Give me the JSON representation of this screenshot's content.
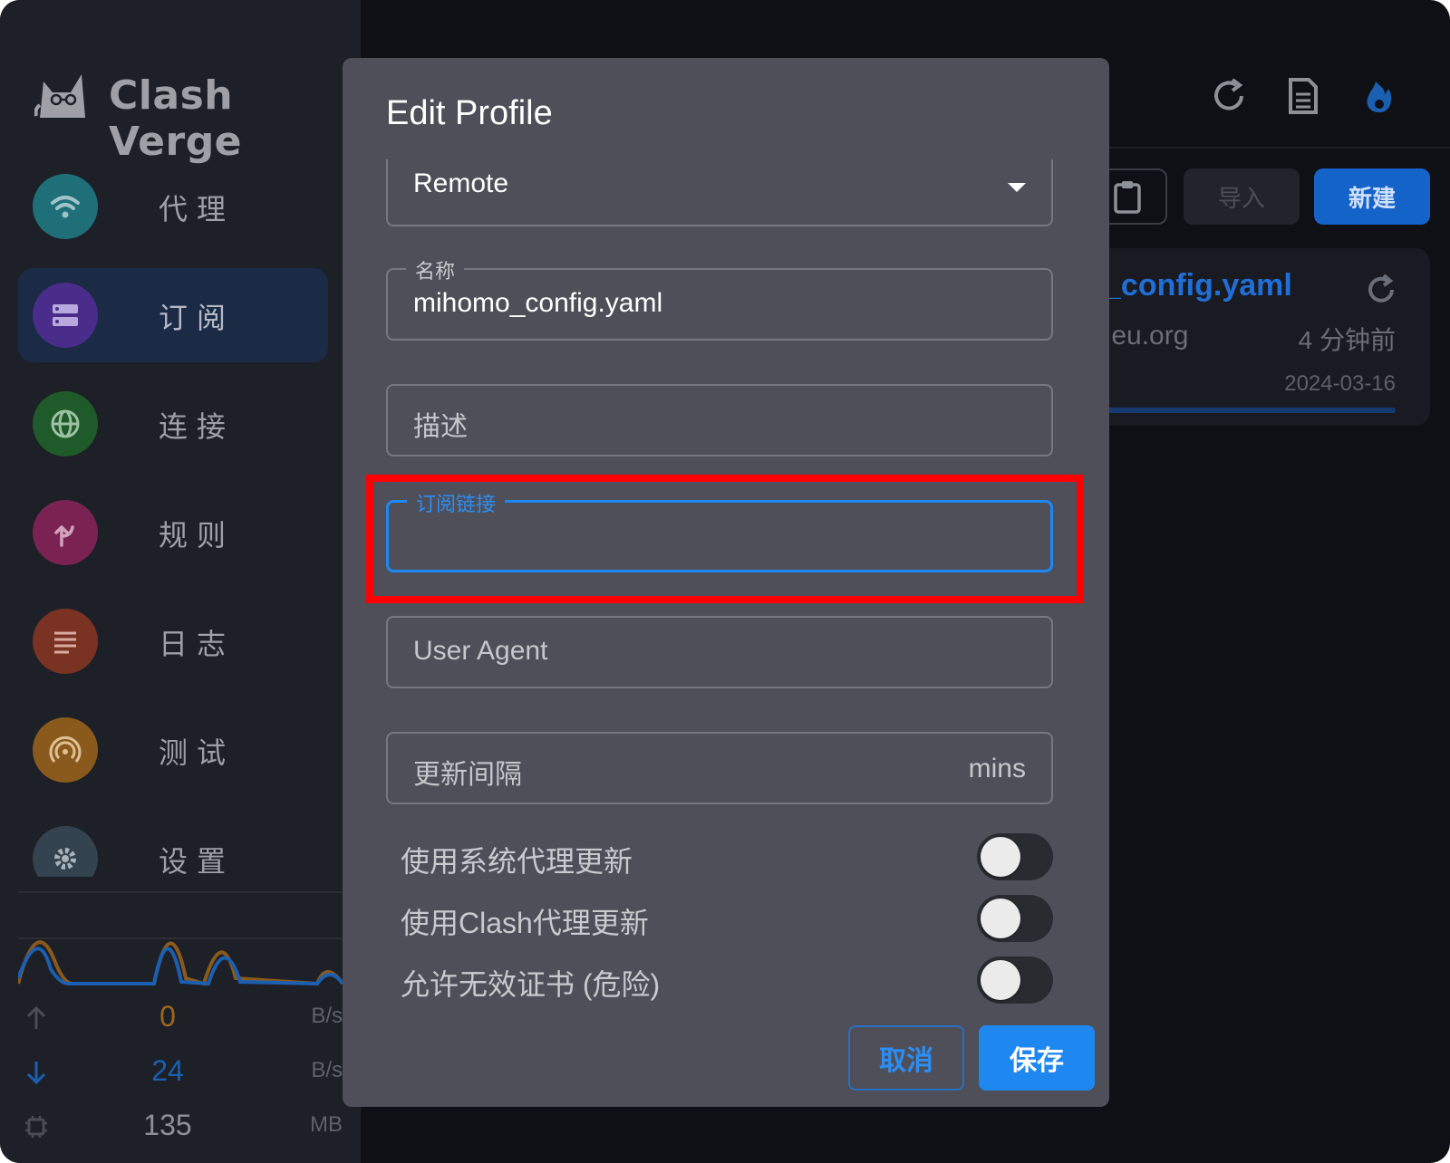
{
  "app": {
    "title": "Clash Verge"
  },
  "sidebar": {
    "items": [
      {
        "label": "代理",
        "color": "#1f6f78",
        "icon": "wifi-icon",
        "active": false
      },
      {
        "label": "订阅",
        "color": "#4a2d8a",
        "icon": "server-icon",
        "active": true
      },
      {
        "label": "连接",
        "color": "#1f5a2a",
        "icon": "globe-icon",
        "active": false
      },
      {
        "label": "规则",
        "color": "#7a2352",
        "icon": "route-icon",
        "active": false
      },
      {
        "label": "日志",
        "color": "#7a3222",
        "icon": "log-icon",
        "active": false
      },
      {
        "label": "测试",
        "color": "#8a5a1c",
        "icon": "radar-icon",
        "active": false
      },
      {
        "label": "设置",
        "color": "#33434f",
        "icon": "gear-icon",
        "active": false
      }
    ],
    "stats": {
      "upload": {
        "value": "0",
        "unit": "B/s",
        "color": "#9a6a1c"
      },
      "download": {
        "value": "24",
        "unit": "B/s",
        "color": "#1b5fb0"
      },
      "memory": {
        "value": "135",
        "unit": "MB",
        "color": "#8e9097"
      }
    }
  },
  "toolbar": {
    "import_label": "导入",
    "new_label": "新建"
  },
  "profile_card": {
    "name": "_config.yaml",
    "host": ".eu.org",
    "updated": "4 分钟前",
    "date": "2024-03-16"
  },
  "modal": {
    "title": "Edit Profile",
    "type_select": {
      "value": "Remote"
    },
    "name_field": {
      "label": "名称",
      "value": "mihomo_config.yaml"
    },
    "desc_field": {
      "placeholder": "描述"
    },
    "url_field": {
      "label": "订阅链接",
      "value": ""
    },
    "ua_field": {
      "placeholder": "User Agent"
    },
    "interval_field": {
      "placeholder": "更新间隔",
      "unit": "mins"
    },
    "switches": [
      {
        "label": "使用系统代理更新",
        "on": false
      },
      {
        "label": "使用Clash代理更新",
        "on": false
      },
      {
        "label": "允许无效证书 (危险)",
        "on": false
      }
    ],
    "cancel_label": "取消",
    "save_label": "保存"
  },
  "colors": {
    "accent": "#1e87f0",
    "highlight": "#ff0000"
  }
}
